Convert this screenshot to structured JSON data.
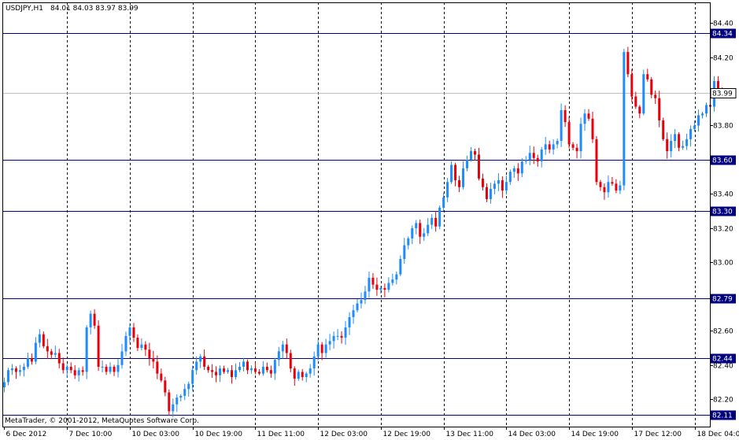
{
  "header": {
    "symbol": "USDJPY,H1",
    "ohlc": "84.01 84.03 83.97 83.99"
  },
  "copyright": "MetaTrader, © 2001-2012, MetaQuotes Software Corp.",
  "colors": {
    "bull": "#1e8cff",
    "bear": "#e8000b",
    "level_line": "#000080",
    "price_line": "#c0c0c0",
    "level_label_bg": "#000080",
    "current_label_bg": "#ffffff"
  },
  "chart_data": {
    "type": "candlestick",
    "ylim": [
      82.04,
      84.52
    ],
    "y_ticks": [
      "84.40",
      "84.20",
      "83.80",
      "83.40",
      "83.20",
      "83.00",
      "82.60",
      "82.40",
      "82.20"
    ],
    "x_ticks": [
      "6 Dec 2012",
      "7 Dec 10:00",
      "10 Dec 03:00",
      "10 Dec 19:00",
      "11 Dec 11:00",
      "12 Dec 03:00",
      "12 Dec 19:00",
      "13 Dec 11:00",
      "14 Dec 03:00",
      "14 Dec 19:00",
      "17 Dec 12:00",
      "18 Dec 04:00"
    ],
    "horizontal_levels": [
      "84.34",
      "83.60",
      "83.30",
      "82.79",
      "82.44",
      "82.11"
    ],
    "current_price": "83.99",
    "candle_count": 180,
    "closes": [
      82.3,
      82.37,
      82.38,
      82.36,
      82.37,
      82.39,
      82.44,
      82.42,
      82.53,
      82.58,
      82.51,
      82.48,
      82.46,
      82.47,
      82.41,
      82.37,
      82.39,
      82.37,
      82.34,
      82.37,
      82.36,
      82.62,
      82.7,
      82.63,
      82.39,
      82.39,
      82.36,
      82.39,
      82.36,
      82.4,
      82.48,
      82.57,
      82.62,
      82.56,
      82.5,
      82.52,
      82.49,
      82.44,
      82.42,
      82.35,
      82.31,
      82.24,
      82.13,
      82.17,
      82.21,
      82.22,
      82.26,
      82.29,
      82.37,
      82.42,
      82.45,
      82.39,
      82.37,
      82.36,
      82.34,
      82.38,
      82.36,
      82.37,
      82.33,
      82.37,
      82.39,
      82.42,
      82.37,
      82.38,
      82.36,
      82.35,
      82.39,
      82.37,
      82.35,
      82.43,
      82.48,
      82.52,
      82.47,
      82.38,
      82.32,
      82.36,
      82.33,
      82.35,
      82.38,
      82.45,
      82.52,
      82.47,
      82.52,
      82.54,
      82.57,
      82.57,
      82.56,
      82.62,
      82.68,
      82.72,
      82.76,
      82.78,
      82.83,
      82.91,
      82.87,
      82.84,
      82.85,
      82.84,
      82.88,
      82.9,
      82.93,
      83.02,
      83.1,
      83.14,
      83.2,
      83.23,
      83.15,
      83.17,
      83.22,
      83.26,
      83.21,
      83.32,
      83.38,
      83.47,
      83.57,
      83.48,
      83.44,
      83.55,
      83.6,
      83.65,
      83.63,
      83.49,
      83.44,
      83.37,
      83.43,
      83.46,
      83.48,
      83.42,
      83.47,
      83.53,
      83.55,
      83.52,
      83.59,
      83.6,
      83.64,
      83.61,
      83.59,
      83.66,
      83.69,
      83.66,
      83.69,
      83.71,
      83.89,
      83.82,
      83.69,
      83.67,
      83.65,
      83.81,
      83.87,
      83.84,
      83.72,
      83.47,
      83.44,
      83.41,
      83.47,
      83.46,
      83.42,
      83.45,
      84.23,
      84.1,
      83.97,
      83.91,
      83.87,
      84.1,
      84.07,
      83.98,
      83.96,
      83.83,
      83.72,
      83.65,
      83.71,
      83.75,
      83.67,
      83.68,
      83.72,
      83.78,
      83.8,
      83.86,
      83.87,
      83.92,
      83.91,
      84.06,
      84.01,
      83.99
    ]
  }
}
